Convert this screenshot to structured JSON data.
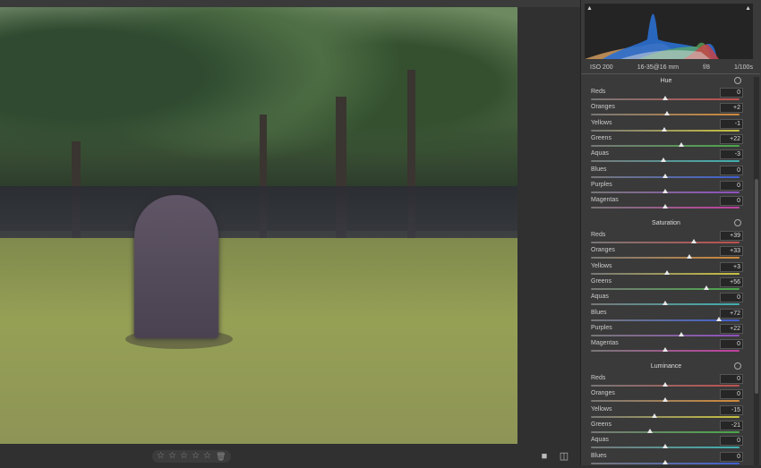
{
  "exif": {
    "iso": "ISO 200",
    "lens": "16-35@16 mm",
    "aperture": "f/8",
    "shutter": "1/100s"
  },
  "colors": {
    "reds": "#c0504d",
    "oranges": "#d08a3a",
    "yellows": "#c8c040",
    "greens": "#4aa84a",
    "aquas": "#40b0b0",
    "blues": "#4060d0",
    "purples": "#9050c0",
    "magentas": "#c040a0"
  },
  "hue": {
    "title": "Hue",
    "items": [
      {
        "label": "Reds",
        "value": "0",
        "level": 0
      },
      {
        "label": "Oranges",
        "value": "+2",
        "level": 2
      },
      {
        "label": "Yellows",
        "value": "-1",
        "level": -1
      },
      {
        "label": "Greens",
        "value": "+22",
        "level": 22
      },
      {
        "label": "Aquas",
        "value": "-3",
        "level": -3
      },
      {
        "label": "Blues",
        "value": "0",
        "level": 0
      },
      {
        "label": "Purples",
        "value": "0",
        "level": 0
      },
      {
        "label": "Magentas",
        "value": "0",
        "level": 0
      }
    ]
  },
  "saturation": {
    "title": "Saturation",
    "items": [
      {
        "label": "Reds",
        "value": "+39",
        "level": 39
      },
      {
        "label": "Oranges",
        "value": "+33",
        "level": 33
      },
      {
        "label": "Yellows",
        "value": "+3",
        "level": 3
      },
      {
        "label": "Greens",
        "value": "+56",
        "level": 56
      },
      {
        "label": "Aquas",
        "value": "0",
        "level": 0
      },
      {
        "label": "Blues",
        "value": "+72",
        "level": 72
      },
      {
        "label": "Purples",
        "value": "+22",
        "level": 22
      },
      {
        "label": "Magentas",
        "value": "0",
        "level": 0
      }
    ]
  },
  "luminance": {
    "title": "Luminance",
    "items": [
      {
        "label": "Reds",
        "value": "0",
        "level": 0
      },
      {
        "label": "Oranges",
        "value": "0",
        "level": 0
      },
      {
        "label": "Yellows",
        "value": "-15",
        "level": -15
      },
      {
        "label": "Greens",
        "value": "-21",
        "level": -21
      },
      {
        "label": "Aquas",
        "value": "0",
        "level": 0
      },
      {
        "label": "Blues",
        "value": "0",
        "level": 0
      }
    ]
  },
  "rating": {
    "stars": [
      "☆",
      "☆",
      "☆",
      "☆",
      "☆"
    ],
    "trash": "🗑"
  },
  "icons": {
    "view_single": "■",
    "view_compare": "◫",
    "target": "target-icon",
    "clip_warning": "▲"
  }
}
